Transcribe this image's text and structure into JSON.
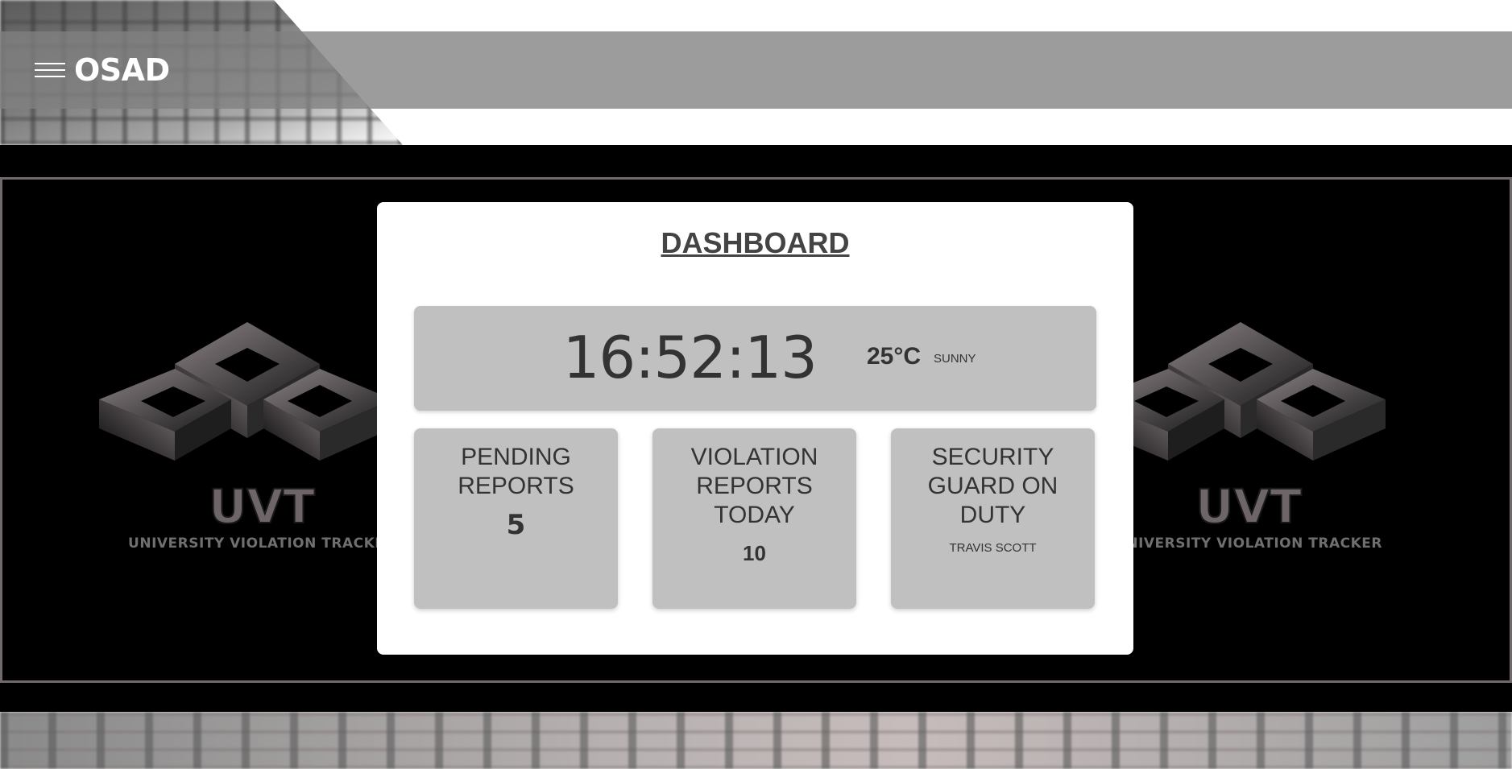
{
  "header": {
    "brand": "OSAD",
    "menu_icon": "hamburger-menu-icon"
  },
  "logo": {
    "abbr": "UVT",
    "tagline": "UNIVERSITY VIOLATION TRACKER"
  },
  "dashboard": {
    "title": "DASHBOARD",
    "clock": {
      "time": "16:52:13",
      "temperature": "25°C",
      "condition": "SUNNY"
    },
    "stats": [
      {
        "label": "PENDING REPORTS",
        "value": "5"
      },
      {
        "label": "VIOLATION REPORTS TODAY",
        "value": "10"
      },
      {
        "label": "SECURITY GUARD ON DUTY",
        "value": "TRAVIS SCOTT"
      }
    ]
  },
  "colors": {
    "navbar": "#808080",
    "panel": "#c0c0c0",
    "text": "#333333",
    "title": "#444444",
    "frame": "#706a6c",
    "logo": "#6e6569"
  }
}
